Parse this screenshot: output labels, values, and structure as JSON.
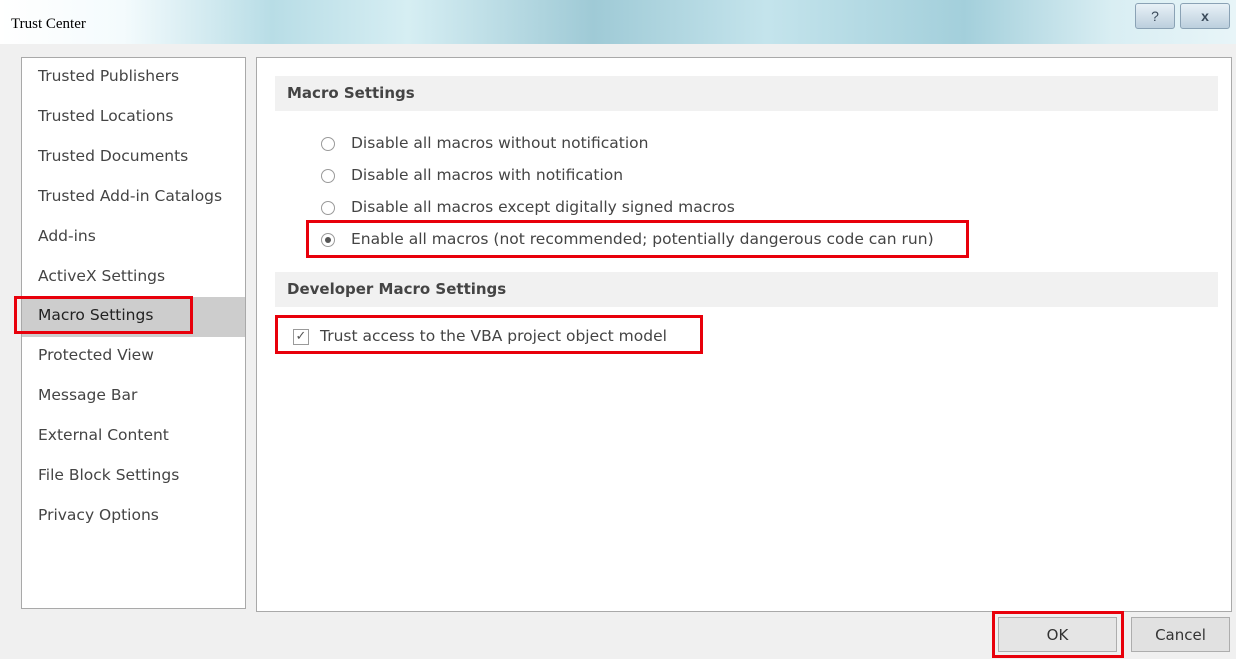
{
  "window": {
    "title": "Trust Center",
    "help_label": "?",
    "close_label": "x"
  },
  "sidebar": {
    "selected_index": 6,
    "items": [
      {
        "label": "Trusted Publishers"
      },
      {
        "label": "Trusted Locations"
      },
      {
        "label": "Trusted Documents"
      },
      {
        "label": "Trusted Add-in Catalogs"
      },
      {
        "label": "Add-ins"
      },
      {
        "label": "ActiveX Settings"
      },
      {
        "label": "Macro Settings"
      },
      {
        "label": "Protected View"
      },
      {
        "label": "Message Bar"
      },
      {
        "label": "External Content"
      },
      {
        "label": "File Block Settings"
      },
      {
        "label": "Privacy Options"
      }
    ]
  },
  "macro_settings": {
    "header": "Macro Settings",
    "selected_index": 3,
    "options": [
      {
        "label": "Disable all macros without notification",
        "selected": false
      },
      {
        "label": "Disable all macros with notification",
        "selected": false
      },
      {
        "label": "Disable all macros except digitally signed macros",
        "selected": false
      },
      {
        "label": "Enable all macros (not recommended; potentially dangerous code can run)",
        "selected": true
      }
    ]
  },
  "developer_macro_settings": {
    "header": "Developer Macro Settings",
    "trust_vba": {
      "label": "Trust access to the VBA project object model",
      "checked": true
    }
  },
  "buttons": {
    "ok": "OK",
    "cancel": "Cancel"
  },
  "colors": {
    "highlight": "#e8000b",
    "selected_item_bg": "#cdcdcd",
    "section_header_bg": "#f1f1f1"
  }
}
